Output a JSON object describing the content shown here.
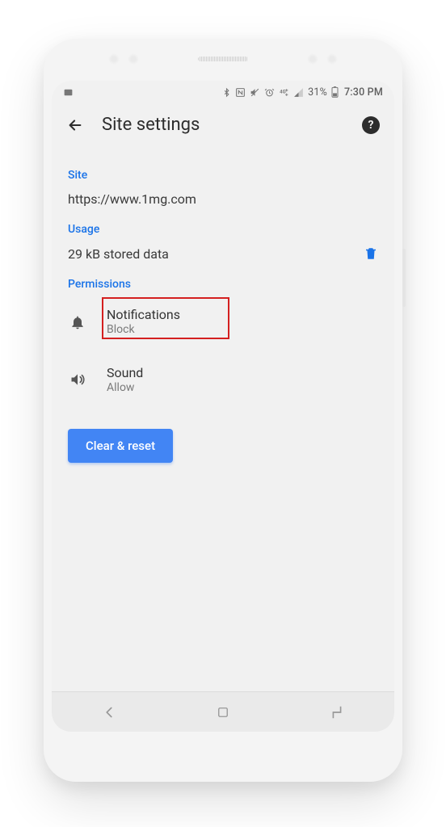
{
  "status": {
    "battery_pct": "31%",
    "clock": "7:30 PM"
  },
  "appbar": {
    "title": "Site settings"
  },
  "site": {
    "label": "Site",
    "url": "https://www.1mg.com"
  },
  "usage": {
    "label": "Usage",
    "text": "29 kB stored data"
  },
  "permissions": {
    "label": "Permissions",
    "items": [
      {
        "title": "Notifications",
        "sub": "Block"
      },
      {
        "title": "Sound",
        "sub": "Allow"
      }
    ]
  },
  "actions": {
    "clear_reset": "Clear & reset"
  }
}
